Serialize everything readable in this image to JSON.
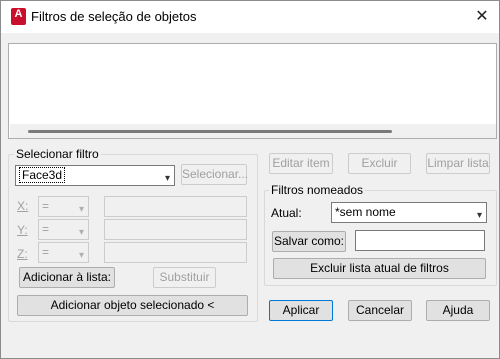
{
  "window": {
    "title": "Filtros de seleção de objetos",
    "app_icon_letter": "A",
    "close_glyph": "✕"
  },
  "select_filter": {
    "group_label": "Selecionar filtro",
    "filter_value": "Face3d",
    "select_button": "Selecionar...",
    "rows": [
      {
        "axis": "X:",
        "operator": "="
      },
      {
        "axis": "Y:",
        "operator": "="
      },
      {
        "axis": "Z:",
        "operator": "="
      }
    ],
    "add_to_list_button": "Adicionar à lista:",
    "replace_button": "Substituir",
    "add_selected_object_button": "Adicionar objeto selecionado <"
  },
  "list_actions": {
    "edit_item_button": "Editar item",
    "delete_button": "Excluir",
    "clear_list_button": "Limpar lista"
  },
  "named_filters": {
    "group_label": "Filtros nomeados",
    "current_label": "Atual:",
    "current_value": "*sem nome",
    "save_as_button": "Salvar como:",
    "save_as_value": "",
    "delete_current_button": "Excluir lista atual de filtros"
  },
  "footer": {
    "apply_button": "Aplicar",
    "cancel_button": "Cancelar",
    "help_button": "Ajuda"
  },
  "colors": {
    "accent": "#0078d7",
    "app_icon": "#c8102e",
    "disabled_text": "#a0a0a0"
  }
}
